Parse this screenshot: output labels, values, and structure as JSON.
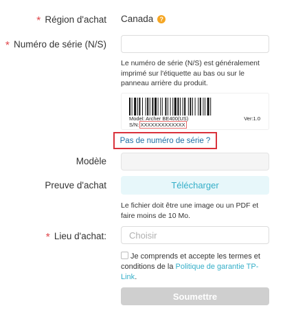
{
  "form": {
    "region": {
      "label": "Région d'achat",
      "value": "Canada",
      "help_icon": "question-circle-icon"
    },
    "serial": {
      "label": "Numéro de série (N/S)",
      "value": "",
      "placeholder": "",
      "hint": "Le numéro de série (N/S) est généralement imprimé sur l'étiquette au bas ou sur le panneau arrière du produit.",
      "barcode": {
        "model": "Model: Archer BE400(US)",
        "version": "Ver:1.0",
        "sn_prefix": "S/N:",
        "sn_value": "XXXXXXXXXXXXX"
      },
      "no_serial_link": "Pas de numéro de série ?"
    },
    "model": {
      "label": "Modèle",
      "value": ""
    },
    "proof": {
      "label": "Preuve d'achat",
      "button": "Télécharger",
      "hint": "Le fichier doit être une image ou un PDF et faire moins de 10 Mo."
    },
    "place": {
      "label": "Lieu d'achat:",
      "placeholder": "Choisir"
    },
    "terms": {
      "text_before": "Je comprends et accepte les termes et conditions de la ",
      "link": "Politique de garantie TP-Link",
      "text_after": "."
    },
    "submit": "Soumettre",
    "required_mark": "*"
  },
  "colors": {
    "accent": "#33aec8",
    "required": "#e0474c",
    "highlight_border": "#d9303a",
    "help_icon": "#f5a623"
  }
}
